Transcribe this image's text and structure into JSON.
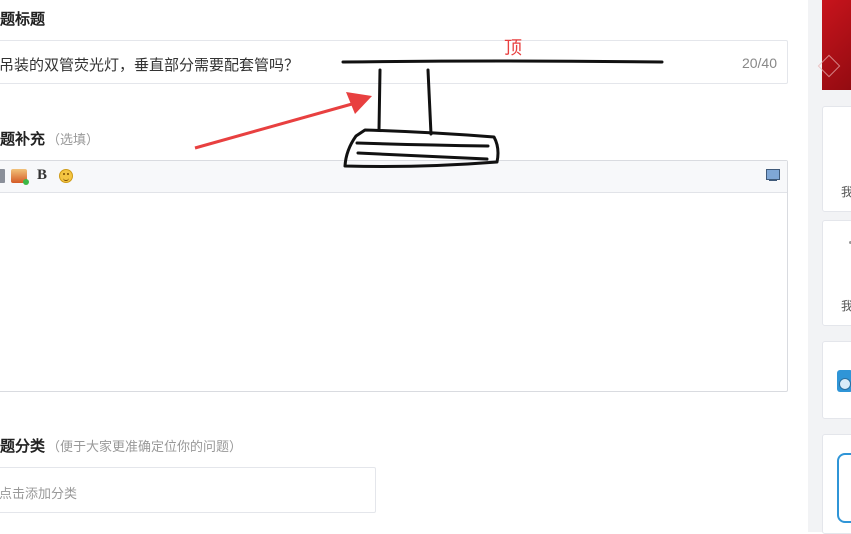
{
  "question": {
    "title_heading": "题标题",
    "title_value": "吊装的双管荧光灯，垂直部分需要配套管吗？",
    "title_counter": "20/40",
    "supplement_heading": "题补充",
    "supplement_hint": "（选填）",
    "category_heading": "题分类",
    "category_hint": "（便于大家更准确定位你的问题）",
    "category_placeholder": "点击添加分类"
  },
  "editor": {
    "toolbar": {
      "bold_label": "B",
      "icons": [
        "list-icon",
        "image-icon",
        "bold-icon",
        "emoji-icon",
        "screen-icon"
      ]
    }
  },
  "sidebar": {
    "card_labels": [
      "我",
      "我"
    ]
  },
  "annotation": {
    "label": "顶",
    "label_color": "#e84040",
    "arrow_color": "#e84040",
    "sketch_color": "#111111"
  }
}
